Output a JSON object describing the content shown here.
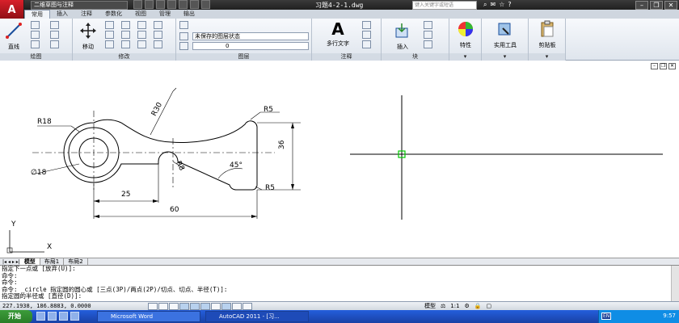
{
  "app": {
    "logo_letter": "A",
    "workspace": "二维草图与注释",
    "document_title": "习题4-2-1.dwg",
    "search_placeholder": "键入关键字或短语"
  },
  "tabs": [
    "常用",
    "插入",
    "注释",
    "参数化",
    "视图",
    "管理",
    "输出"
  ],
  "ribbon": {
    "draw_panel": {
      "line_label": "直线",
      "title": "绘图"
    },
    "modify_panel": {
      "move_label": "移动",
      "title": "修改"
    },
    "layer_panel": {
      "layer_state": "未保存的图层状态",
      "current_layer": "0",
      "title": "图层"
    },
    "annotation_panel": {
      "mtext_label": "多行文字",
      "title": "注释"
    },
    "block_panel": {
      "insert_label": "插入",
      "title": "块"
    },
    "properties_label": "特性",
    "utilities_label": "实用工具",
    "clipboard_label": "剪贴板"
  },
  "drawing": {
    "dimensions": {
      "r18": "R18",
      "r30": "R30",
      "r5_top": "R5",
      "r5_bottom": "R5",
      "r8": "R8",
      "dia18": "∅18",
      "angle": "45°",
      "d25": "25",
      "d60": "60",
      "d36": "36"
    },
    "ucs": {
      "x": "X",
      "y": "Y"
    }
  },
  "layout_tabs": [
    "模型",
    "布局1",
    "布局2"
  ],
  "command_lines": [
    "指定下一点或 [放弃(U)]:",
    "命令:",
    "命令:",
    "命令: _circle 指定圆的圆心或 [三点(3P)/两点(2P)/切点、切点、半径(T)]:",
    "指定圆的半径或 [直径(D)]:"
  ],
  "status": {
    "coordinates": "227.1938, 186.8883, 0.0000",
    "model_label": "模型",
    "scale": "1:1"
  },
  "taskbar": {
    "start": "开始",
    "tasks": [
      "Microsoft Word",
      "AutoCAD 2011 - [习..."
    ],
    "lang": "EN",
    "clock": "9:57"
  }
}
